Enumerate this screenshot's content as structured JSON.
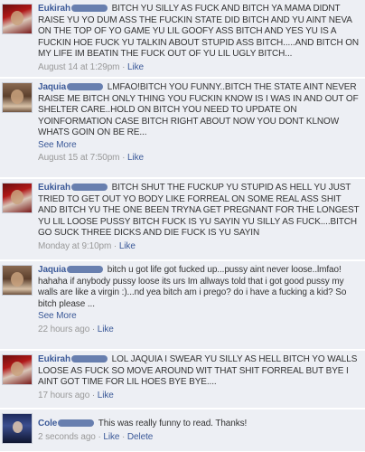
{
  "comments": [
    {
      "author": "Eukirah",
      "text": "BITCH YU SILLY AS FUCK AND BITCH YA MAMA DIDNT RAISE YU YO DUM ASS THE FUCKIN STATE DID BITCH AND YU AINT NEVA ON THE TOP OF YO GAME YU LIL GOOFY ASS BITCH AND YES YU IS A FUCKIN HOE FUCK YU TALKIN ABOUT STUPID ASS BITCH.....AND BITCH ON MY LIFE IM BEATIN THE FUCK OUT OF YU LIL UGLY BITCH...",
      "time": "August 14 at 1:29pm",
      "like": "Like"
    },
    {
      "author": "Jaquia",
      "text": "LMFAO!BITCH YOU FUNNY..BITCH THE STATE AINT NEVER RAISE ME BITCH ONLY THING YOU FUCKIN KNOW IS I WAS IN AND OUT OF SHELTER CARE..HOLD ON BITCH YOU NEED TO UPDATE ON YOINFORMATION CASE BITCH RIGHT ABOUT NOW YOU DONT KLNOW WHATS GOIN ON BE RE...",
      "see_more": "See More",
      "time": "August 15 at 7:50pm",
      "like": "Like"
    },
    {
      "author": "Eukirah",
      "text": "BITCH SHUT THE FUCKUP YU STUPID AS HELL YU JUST TRIED TO GET OUT YO BODY LIKE FORREAL ON SOME REAL ASS SHIT AND BITCH YU THE ONE BEEN TRYNA GET PREGNANT FOR THE LONGEST YU LIL LOOSE PUSSY BITCH FUCK IS YU SAYIN YU SILLY AS FUCK....BITCH GO SUCK THREE DICKS AND DIE FUCK IS YU SAYIN",
      "time": "Monday at 9:10pm",
      "like": "Like"
    },
    {
      "author": "Jaquia",
      "text": "bitch u got life got fucked up...pussy aint never loose..lmfao! hahaha if anybody pussy loose its urs Im allways told that i got good pussy my walls are like a virgin :)...nd yea bitch am i prego? do i have a fucking a kid? So bitch please ...",
      "see_more": "See More",
      "time": "22 hours ago",
      "like": "Like"
    },
    {
      "author": "Eukirah",
      "text": "LOL JAQUIA I SWEAR YU SILLY AS HELL BITCH YO WALLS LOOSE AS FUCK SO MOVE AROUND WIT THAT SHIT FORREAL BUT BYE I AINT GOT TIME FOR LIL HOES BYE BYE....",
      "time": "17 hours ago",
      "like": "Like"
    },
    {
      "author": "Cole",
      "text": "This was really funny to read. Thanks!",
      "time": "2 seconds ago",
      "like": "Like",
      "delete": "Delete"
    }
  ],
  "colors": {
    "background": "#edeff4",
    "link": "#3b5998",
    "meta": "#999999",
    "text": "#333333"
  }
}
